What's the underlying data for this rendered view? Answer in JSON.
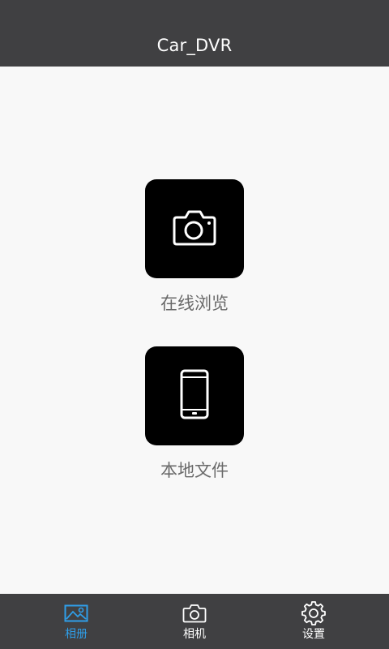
{
  "app": {
    "title": "Car_DVR"
  },
  "main": {
    "tiles": [
      {
        "label": "在线浏览",
        "icon": "camera-icon"
      },
      {
        "label": "本地文件",
        "icon": "phone-icon"
      }
    ]
  },
  "tabbar": {
    "active_index": 0,
    "active_color": "#2f9ee8",
    "items": [
      {
        "label": "相册",
        "icon": "gallery-icon"
      },
      {
        "label": "相机",
        "icon": "camera-icon"
      },
      {
        "label": "设置",
        "icon": "gear-icon"
      }
    ]
  },
  "colors": {
    "header_bg": "#404042",
    "tile_bg": "#000000",
    "page_bg": "#f8f8f8"
  }
}
